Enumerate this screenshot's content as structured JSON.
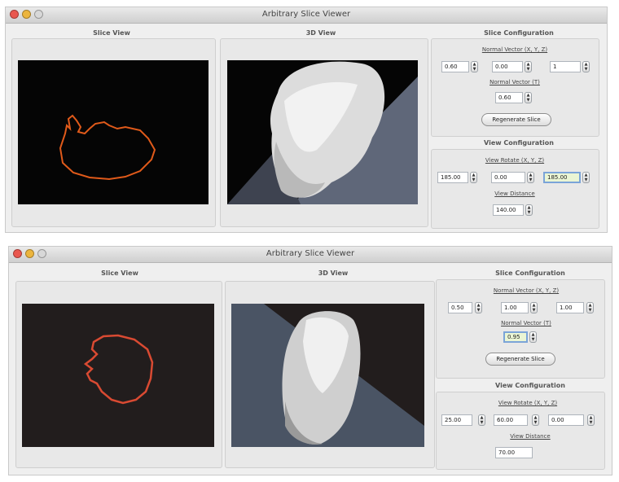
{
  "window1": {
    "title": "Arbitrary Slice Viewer",
    "slice_view_title": "Slice View",
    "view3d_title": "3D View",
    "slice_config": {
      "title": "Slice Configuration",
      "normal_vector_label": "Normal Vector (X, Y, Z)",
      "normal_vector": [
        "0.60",
        "0.00",
        "1"
      ],
      "normal_vector_t_label": "Normal Vector (T)",
      "normal_vector_t": "0.60",
      "regenerate_label": "Regenerate Slice"
    },
    "view_config": {
      "title": "View Configuration",
      "view_rotate_label": "View Rotate (X, Y, Z)",
      "view_rotate": [
        "185.00",
        "0.00",
        "185.00"
      ],
      "view_distance_label": "View Distance",
      "view_distance": "140.00"
    }
  },
  "window2": {
    "title": "Arbitrary Slice Viewer",
    "slice_view_title": "Slice View",
    "view3d_title": "3D View",
    "slice_config": {
      "title": "Slice Configuration",
      "normal_vector_label": "Normal Vector (X, Y, Z)",
      "normal_vector": [
        "0.50",
        "1.00",
        "1.00"
      ],
      "normal_vector_t_label": "Normal Vector (T)",
      "normal_vector_t": "0.95",
      "regenerate_label": "Regenerate Slice"
    },
    "view_config": {
      "title": "View Configuration",
      "view_rotate_label": "View Rotate (X, Y, Z)",
      "view_rotate": [
        "25.00",
        "60.00",
        "0.00"
      ],
      "view_distance_label": "View Distance",
      "view_distance": "70.00"
    }
  },
  "colors": {
    "contour1": "#e05a1a",
    "contour2": "#d94a32",
    "focus_bg": "#eaf5d4"
  },
  "icons": [
    "close-icon",
    "minimize-icon",
    "zoom-icon",
    "stepper-icon"
  ]
}
